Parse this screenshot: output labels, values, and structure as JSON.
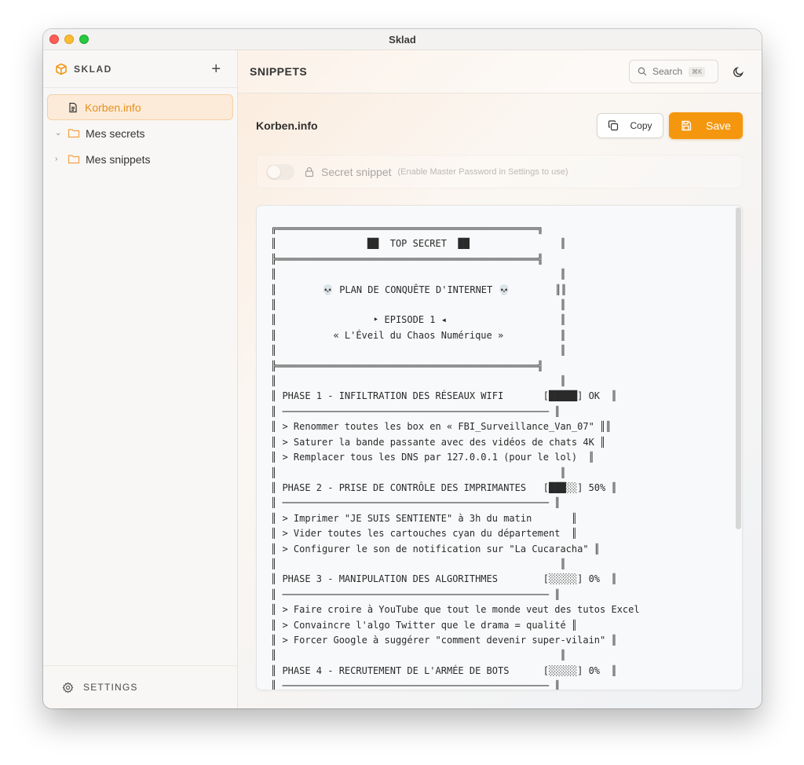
{
  "window": {
    "title": "Sklad"
  },
  "sidebar": {
    "brand": "SKLAD",
    "add_label": "+",
    "items": [
      {
        "label": "Korben.info",
        "type": "file",
        "active": true
      },
      {
        "label": "Mes secrets",
        "type": "folder",
        "expanded": true
      },
      {
        "label": "Mes snippets",
        "type": "folder",
        "expanded": false
      }
    ],
    "settings_label": "SETTINGS"
  },
  "topbar": {
    "title": "SNIPPETS",
    "search_placeholder": "Search",
    "search_shortcut": "⌘K"
  },
  "snippet": {
    "title": "Korben.info",
    "copy_label": "Copy",
    "save_label": "Save",
    "secret_label": "Secret snippet",
    "secret_hint": "(Enable Master Password in Settings to use)",
    "secret_enabled": false,
    "content": "╔══════════════════════════════════════════════╗\n║                ██  TOP SECRET  ██                ║\n╠══════════════════════════════════════════════╣\n║                                                  ║\n║        💀 PLAN DE CONQUÊTE D'INTERNET 💀        ║║\n║                                                  ║\n║                 ‣ EPISODE 1 ◂                    ║\n║          « L'Éveil du Chaos Numérique »          ║\n║                                                  ║\n╠══════════════════════════════════════════════╣\n║                                                  ║\n║ PHASE 1 - INFILTRATION DES RÉSEAUX WIFI       [█████] OK  ║\n║ ─────────────────────────────────────────────── ║\n║ > Renommer toutes les box en « FBI_Surveillance_Van_07\" ║║\n║ > Saturer la bande passante avec des vidéos de chats 4K ║\n║ > Remplacer tous les DNS par 127.0.0.1 (pour le lol)  ║\n║                                                  ║\n║ PHASE 2 - PRISE DE CONTRÔLE DES IMPRIMANTES   [███░░] 50% ║\n║ ─────────────────────────────────────────────── ║\n║ > Imprimer \"JE SUIS SENTIENTE\" à 3h du matin       ║\n║ > Vider toutes les cartouches cyan du département  ║\n║ > Configurer le son de notification sur \"La Cucaracha\" ║\n║                                                  ║\n║ PHASE 3 - MANIPULATION DES ALGORITHMES        [░░░░░] 0%  ║\n║ ─────────────────────────────────────────────── ║\n║ > Faire croire à YouTube que tout le monde veut des tutos Excel\n║ > Convaincre l'algo Twitter que le drama = qualité ║\n║ > Forcer Google à suggérer \"comment devenir super-vilain\" ║\n║                                                  ║\n║ PHASE 4 - RECRUTEMENT DE L'ARMÉE DE BOTS      [░░░░░] 0%  ║\n║ ─────────────────────────────────────────────── ║"
  }
}
